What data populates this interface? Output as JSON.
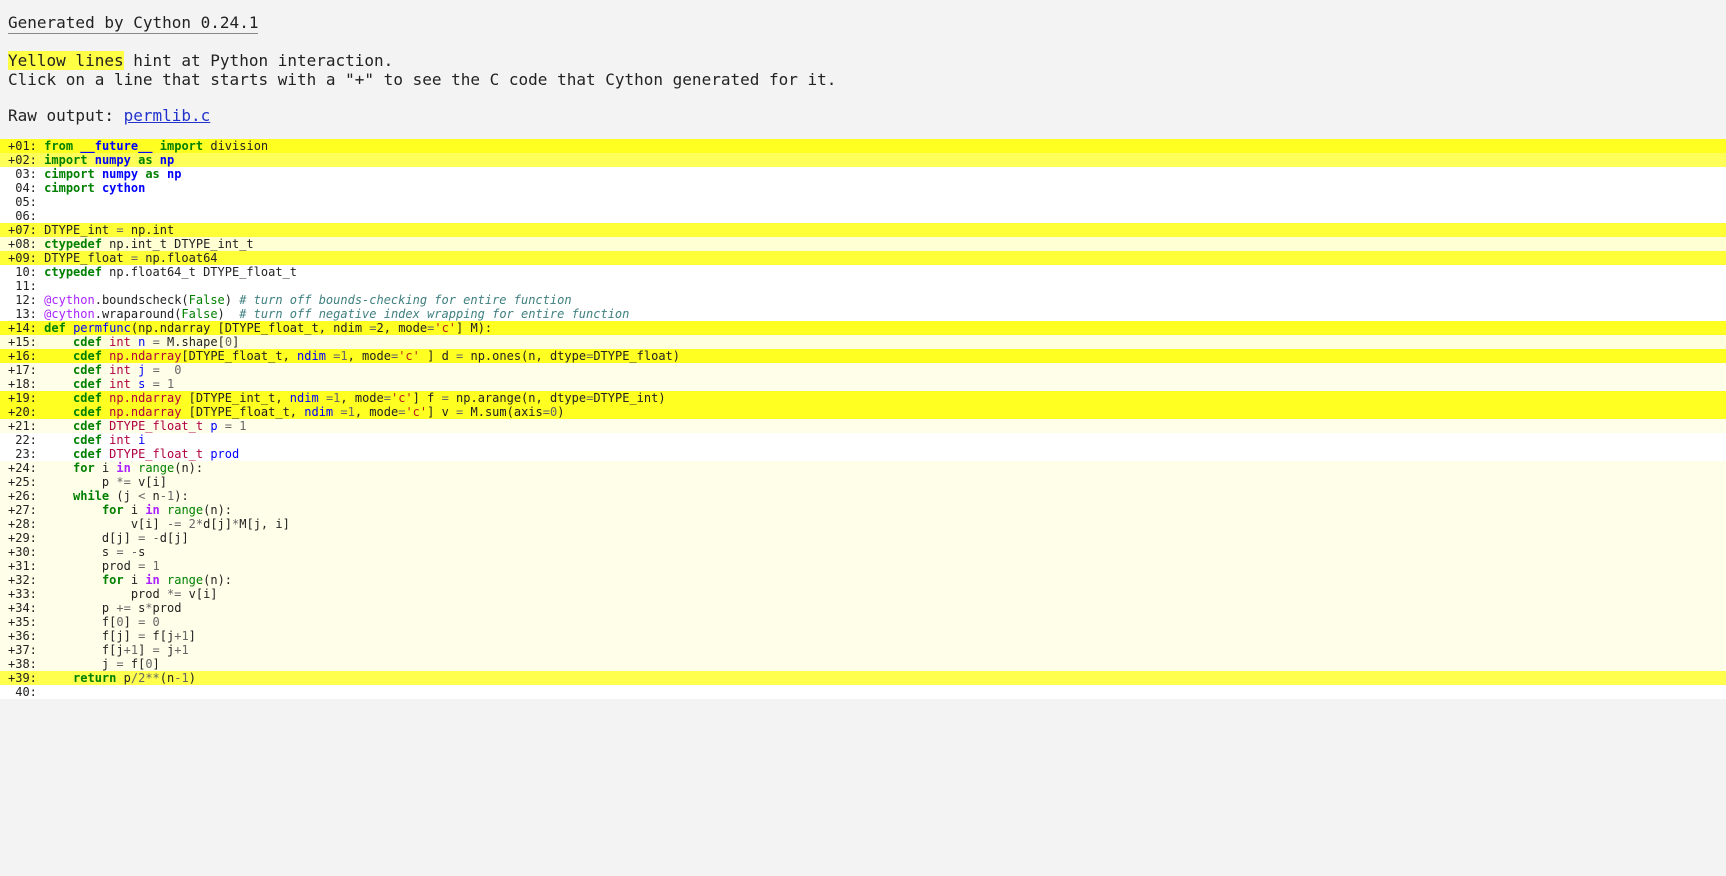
{
  "header": {
    "generated_by": "Generated by Cython 0.24.1"
  },
  "hint": {
    "highlight": "Yellow lines",
    "rest_line1": " hint at Python interaction.",
    "line2": "Click on a line that starts with a \"+\" to see the C code that Cython generated for it."
  },
  "raw_output": {
    "label": "Raw output: ",
    "link": "permlib.c"
  },
  "colors": {
    "page_background": "#f3f3f3",
    "yellow_highlight": "#ffff44",
    "link": "#2233cc",
    "keyword_green": "#008000",
    "keyword_blue": "#0000ff",
    "keyword_purple": "#aa22ff"
  },
  "code_lines": [
    {
      "num": "+01:",
      "score": 1.0,
      "tokens": [
        [
          " ",
          ""
        ],
        [
          "from",
          "k"
        ],
        [
          " ",
          ""
        ],
        [
          "__future__",
          "kn"
        ],
        [
          " ",
          ""
        ],
        [
          "import",
          "k"
        ],
        [
          " division",
          ""
        ]
      ]
    },
    {
      "num": "+02:",
      "score": 0.75,
      "tokens": [
        [
          " ",
          ""
        ],
        [
          "import",
          "k"
        ],
        [
          " ",
          ""
        ],
        [
          "numpy",
          "kn"
        ],
        [
          " ",
          ""
        ],
        [
          "as",
          "k"
        ],
        [
          " ",
          ""
        ],
        [
          "np",
          "kn"
        ]
      ]
    },
    {
      "num": " 03:",
      "score": 0,
      "tokens": [
        [
          " ",
          ""
        ],
        [
          "cimport",
          "k"
        ],
        [
          " ",
          ""
        ],
        [
          "numpy",
          "kn"
        ],
        [
          " ",
          ""
        ],
        [
          "as",
          "k"
        ],
        [
          " ",
          ""
        ],
        [
          "np",
          "kn"
        ]
      ]
    },
    {
      "num": " 04:",
      "score": 0,
      "tokens": [
        [
          " ",
          ""
        ],
        [
          "cimport",
          "k"
        ],
        [
          " ",
          ""
        ],
        [
          "cython",
          "kn"
        ]
      ]
    },
    {
      "num": " 05:",
      "score": 0,
      "tokens": []
    },
    {
      "num": " 06:",
      "score": 0,
      "tokens": []
    },
    {
      "num": "+07:",
      "score": 0.9,
      "tokens": [
        [
          " DTYPE_int ",
          ""
        ],
        [
          "=",
          "o"
        ],
        [
          " np.int",
          ""
        ]
      ]
    },
    {
      "num": "+08:",
      "score": 0.2,
      "tokens": [
        [
          " ",
          ""
        ],
        [
          "ctypedef",
          "k"
        ],
        [
          " np.int_t DTYPE_int_t",
          ""
        ]
      ]
    },
    {
      "num": "+09:",
      "score": 0.9,
      "tokens": [
        [
          " DTYPE_float ",
          ""
        ],
        [
          "=",
          "o"
        ],
        [
          " np.float64",
          ""
        ]
      ]
    },
    {
      "num": " 10:",
      "score": 0,
      "tokens": [
        [
          " ",
          ""
        ],
        [
          "ctypedef",
          "k"
        ],
        [
          " np.float64_t DTYPE_float_t",
          ""
        ]
      ]
    },
    {
      "num": " 11:",
      "score": 0,
      "tokens": []
    },
    {
      "num": " 12:",
      "score": 0,
      "tokens": [
        [
          " ",
          ""
        ],
        [
          "@cython",
          "dc"
        ],
        [
          ".boundscheck(",
          ""
        ],
        [
          "False",
          "nb"
        ],
        [
          ") ",
          ""
        ],
        [
          "# turn off bounds-checking for entire function",
          "c"
        ]
      ]
    },
    {
      "num": " 13:",
      "score": 0,
      "tokens": [
        [
          " ",
          ""
        ],
        [
          "@cython",
          "dc"
        ],
        [
          ".wraparound(",
          ""
        ],
        [
          "False",
          "nb"
        ],
        [
          ")  ",
          ""
        ],
        [
          "# turn off negative index wrapping for entire function",
          "c"
        ]
      ]
    },
    {
      "num": "+14:",
      "score": 1.0,
      "tokens": [
        [
          " ",
          ""
        ],
        [
          "def",
          "k"
        ],
        [
          " ",
          ""
        ],
        [
          "permfunc",
          "nf"
        ],
        [
          "(np.ndarray [DTYPE_float_t, ndim ",
          ""
        ],
        [
          "=",
          "o"
        ],
        [
          "2",
          ""
        ],
        [
          ", mode",
          ""
        ],
        [
          "=",
          "o"
        ],
        [
          "'c'",
          "s"
        ],
        [
          "] M):",
          ""
        ]
      ]
    },
    {
      "num": "+15:",
      "score": 0.15,
      "tokens": [
        [
          "     ",
          ""
        ],
        [
          "cdef",
          "k"
        ],
        [
          " ",
          ""
        ],
        [
          "int",
          "kt"
        ],
        [
          " ",
          ""
        ],
        [
          "n",
          "nf"
        ],
        [
          " ",
          ""
        ],
        [
          "=",
          "o"
        ],
        [
          " M.shape[",
          ""
        ],
        [
          "0",
          "mi"
        ],
        [
          "]",
          ""
        ]
      ]
    },
    {
      "num": "+16:",
      "score": 1.0,
      "tokens": [
        [
          "     ",
          ""
        ],
        [
          "cdef",
          "k"
        ],
        [
          " ",
          ""
        ],
        [
          "np.ndarray",
          "kt"
        ],
        [
          "[DTYPE_float_t, ",
          ""
        ],
        [
          "ndim",
          "nf"
        ],
        [
          " ",
          ""
        ],
        [
          "=1",
          "mi"
        ],
        [
          ", mode",
          ""
        ],
        [
          "=",
          "o"
        ],
        [
          "'c'",
          "s"
        ],
        [
          " ] d ",
          ""
        ],
        [
          "=",
          "o"
        ],
        [
          " np.ones(n, dtype",
          ""
        ],
        [
          "=",
          "o"
        ],
        [
          "DTYPE_float)",
          ""
        ]
      ]
    },
    {
      "num": "+17:",
      "score": 0.1,
      "tokens": [
        [
          "     ",
          ""
        ],
        [
          "cdef",
          "k"
        ],
        [
          " ",
          ""
        ],
        [
          "int",
          "kt"
        ],
        [
          " ",
          ""
        ],
        [
          "j",
          "nf"
        ],
        [
          " ",
          ""
        ],
        [
          "=",
          "o"
        ],
        [
          "  ",
          ""
        ],
        [
          "0",
          "mi"
        ]
      ]
    },
    {
      "num": "+18:",
      "score": 0.1,
      "tokens": [
        [
          "     ",
          ""
        ],
        [
          "cdef",
          "k"
        ],
        [
          " ",
          ""
        ],
        [
          "int",
          "kt"
        ],
        [
          " ",
          ""
        ],
        [
          "s",
          "nf"
        ],
        [
          " ",
          ""
        ],
        [
          "=",
          "o"
        ],
        [
          " ",
          ""
        ],
        [
          "1",
          "mi"
        ]
      ]
    },
    {
      "num": "+19:",
      "score": 1.0,
      "tokens": [
        [
          "     ",
          ""
        ],
        [
          "cdef",
          "k"
        ],
        [
          " ",
          ""
        ],
        [
          "np.ndarray",
          "kt"
        ],
        [
          " [DTYPE_int_t, ",
          ""
        ],
        [
          "ndim",
          "nf"
        ],
        [
          " ",
          ""
        ],
        [
          "=1",
          "mi"
        ],
        [
          ", mode",
          ""
        ],
        [
          "=",
          "o"
        ],
        [
          "'c'",
          "s"
        ],
        [
          "] f ",
          ""
        ],
        [
          "=",
          "o"
        ],
        [
          " np.arange(n, dtype",
          ""
        ],
        [
          "=",
          "o"
        ],
        [
          "DTYPE_int)",
          ""
        ]
      ]
    },
    {
      "num": "+20:",
      "score": 1.0,
      "tokens": [
        [
          "     ",
          ""
        ],
        [
          "cdef",
          "k"
        ],
        [
          " ",
          ""
        ],
        [
          "np.ndarray",
          "kt"
        ],
        [
          " [DTYPE_float_t, ",
          ""
        ],
        [
          "ndim",
          "nf"
        ],
        [
          " ",
          ""
        ],
        [
          "=1",
          "mi"
        ],
        [
          ", mode",
          ""
        ],
        [
          "=",
          "o"
        ],
        [
          "'c'",
          "s"
        ],
        [
          "] v ",
          ""
        ],
        [
          "=",
          "o"
        ],
        [
          " M.sum(axis",
          ""
        ],
        [
          "=",
          "o"
        ],
        [
          "0",
          "mi"
        ],
        [
          ")",
          ""
        ]
      ]
    },
    {
      "num": "+21:",
      "score": 0.1,
      "tokens": [
        [
          "     ",
          ""
        ],
        [
          "cdef",
          "k"
        ],
        [
          " ",
          ""
        ],
        [
          "DTYPE_float_t",
          "kt"
        ],
        [
          " ",
          ""
        ],
        [
          "p",
          "nf"
        ],
        [
          " ",
          ""
        ],
        [
          "=",
          "o"
        ],
        [
          " ",
          ""
        ],
        [
          "1",
          "mi"
        ]
      ]
    },
    {
      "num": " 22:",
      "score": 0,
      "tokens": [
        [
          "     ",
          ""
        ],
        [
          "cdef",
          "k"
        ],
        [
          " ",
          ""
        ],
        [
          "int",
          "kt"
        ],
        [
          " ",
          ""
        ],
        [
          "i",
          "nf"
        ]
      ]
    },
    {
      "num": " 23:",
      "score": 0,
      "tokens": [
        [
          "     ",
          ""
        ],
        [
          "cdef",
          "k"
        ],
        [
          " ",
          ""
        ],
        [
          "DTYPE_float_t",
          "kt"
        ],
        [
          " ",
          ""
        ],
        [
          "prod",
          "nf"
        ]
      ]
    },
    {
      "num": "+24:",
      "score": 0.1,
      "tokens": [
        [
          "     ",
          ""
        ],
        [
          "for",
          "k"
        ],
        [
          " i ",
          ""
        ],
        [
          "in",
          "kw"
        ],
        [
          " ",
          ""
        ],
        [
          "range",
          "nb"
        ],
        [
          "(n):",
          ""
        ]
      ]
    },
    {
      "num": "+25:",
      "score": 0.1,
      "tokens": [
        [
          "         p ",
          ""
        ],
        [
          "*=",
          "o"
        ],
        [
          " v[i]",
          ""
        ]
      ]
    },
    {
      "num": "+26:",
      "score": 0.1,
      "tokens": [
        [
          "     ",
          ""
        ],
        [
          "while",
          "k"
        ],
        [
          " (j ",
          ""
        ],
        [
          "<",
          "o"
        ],
        [
          " n",
          ""
        ],
        [
          "-",
          "o"
        ],
        [
          "1",
          "mi"
        ],
        [
          "):",
          ""
        ]
      ]
    },
    {
      "num": "+27:",
      "score": 0.1,
      "tokens": [
        [
          "         ",
          ""
        ],
        [
          "for",
          "k"
        ],
        [
          " i ",
          ""
        ],
        [
          "in",
          "kw"
        ],
        [
          " ",
          ""
        ],
        [
          "range",
          "nb"
        ],
        [
          "(n):",
          ""
        ]
      ]
    },
    {
      "num": "+28:",
      "score": 0.1,
      "tokens": [
        [
          "             v[i] ",
          ""
        ],
        [
          "-=",
          "o"
        ],
        [
          " ",
          ""
        ],
        [
          "2",
          "mi"
        ],
        [
          "*",
          "o"
        ],
        [
          "d[j]",
          ""
        ],
        [
          "*",
          "o"
        ],
        [
          "M[j, i]",
          ""
        ]
      ]
    },
    {
      "num": "+29:",
      "score": 0.1,
      "tokens": [
        [
          "         d[j] ",
          ""
        ],
        [
          "=",
          "o"
        ],
        [
          " ",
          ""
        ],
        [
          "-",
          "o"
        ],
        [
          "d[j]",
          ""
        ]
      ]
    },
    {
      "num": "+30:",
      "score": 0.1,
      "tokens": [
        [
          "         s ",
          ""
        ],
        [
          "=",
          "o"
        ],
        [
          " ",
          ""
        ],
        [
          "-",
          "o"
        ],
        [
          "s",
          ""
        ]
      ]
    },
    {
      "num": "+31:",
      "score": 0.1,
      "tokens": [
        [
          "         prod ",
          ""
        ],
        [
          "=",
          "o"
        ],
        [
          " ",
          ""
        ],
        [
          "1",
          "mi"
        ]
      ]
    },
    {
      "num": "+32:",
      "score": 0.1,
      "tokens": [
        [
          "         ",
          ""
        ],
        [
          "for",
          "k"
        ],
        [
          " i ",
          ""
        ],
        [
          "in",
          "kw"
        ],
        [
          " ",
          ""
        ],
        [
          "range",
          "nb"
        ],
        [
          "(n):",
          ""
        ]
      ]
    },
    {
      "num": "+33:",
      "score": 0.1,
      "tokens": [
        [
          "             prod ",
          ""
        ],
        [
          "*=",
          "o"
        ],
        [
          " v[i]",
          ""
        ]
      ]
    },
    {
      "num": "+34:",
      "score": 0.1,
      "tokens": [
        [
          "         p ",
          ""
        ],
        [
          "+=",
          "o"
        ],
        [
          " s",
          ""
        ],
        [
          "*",
          "o"
        ],
        [
          "prod",
          ""
        ]
      ]
    },
    {
      "num": "+35:",
      "score": 0.1,
      "tokens": [
        [
          "         f[",
          ""
        ],
        [
          "0",
          "mi"
        ],
        [
          "] ",
          ""
        ],
        [
          "=",
          "o"
        ],
        [
          " ",
          ""
        ],
        [
          "0",
          "mi"
        ]
      ]
    },
    {
      "num": "+36:",
      "score": 0.1,
      "tokens": [
        [
          "         f[j] ",
          ""
        ],
        [
          "=",
          "o"
        ],
        [
          " f[j",
          ""
        ],
        [
          "+",
          "o"
        ],
        [
          "1",
          "mi"
        ],
        [
          "]",
          ""
        ]
      ]
    },
    {
      "num": "+37:",
      "score": 0.1,
      "tokens": [
        [
          "         f[j",
          ""
        ],
        [
          "+",
          "o"
        ],
        [
          "1",
          "mi"
        ],
        [
          "] ",
          ""
        ],
        [
          "=",
          "o"
        ],
        [
          " j",
          ""
        ],
        [
          "+",
          "o"
        ],
        [
          "1",
          "mi"
        ]
      ]
    },
    {
      "num": "+38:",
      "score": 0.1,
      "tokens": [
        [
          "         j ",
          ""
        ],
        [
          "=",
          "o"
        ],
        [
          " f[",
          ""
        ],
        [
          "0",
          "mi"
        ],
        [
          "]",
          ""
        ]
      ]
    },
    {
      "num": "+39:",
      "score": 0.8,
      "tokens": [
        [
          "     ",
          ""
        ],
        [
          "return",
          "k"
        ],
        [
          " p",
          ""
        ],
        [
          "/",
          "o"
        ],
        [
          "2",
          "mi"
        ],
        [
          "**",
          "o"
        ],
        [
          "(n",
          ""
        ],
        [
          "-",
          "o"
        ],
        [
          "1",
          "mi"
        ],
        [
          ")",
          ""
        ]
      ]
    },
    {
      "num": " 40:",
      "score": 0,
      "tokens": []
    }
  ]
}
